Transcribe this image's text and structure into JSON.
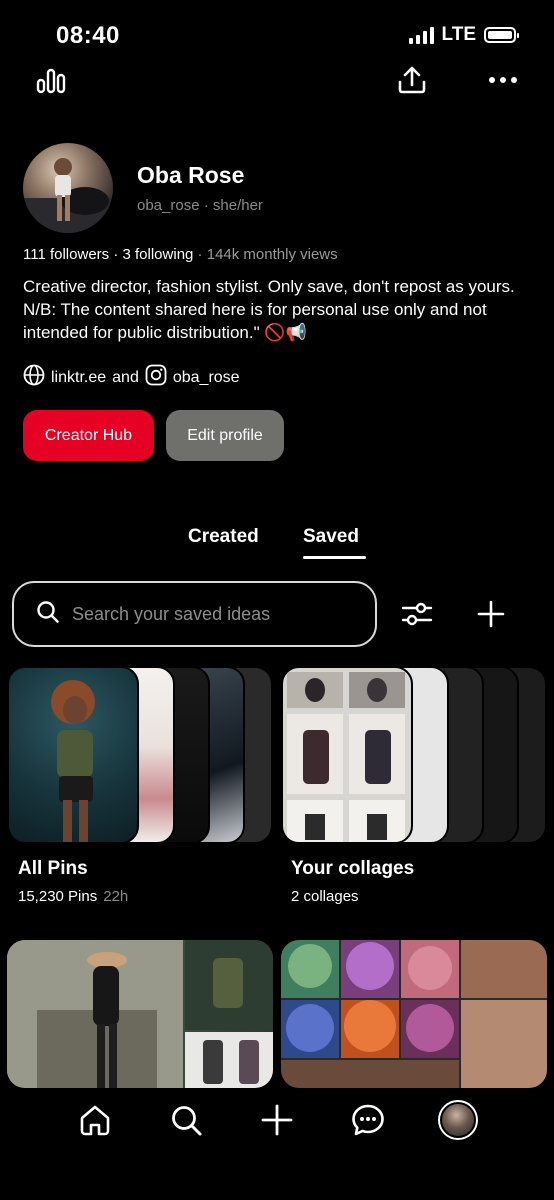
{
  "status_bar": {
    "time": "08:40",
    "network": "LTE"
  },
  "profile": {
    "name": "Oba Rose",
    "handle_line": "oba_rose · she/her",
    "followers": "111 followers",
    "following": "3 following",
    "monthly_views": "144k monthly views",
    "bio": "Creative director, fashion stylist. Only save, don't repost as yours. N/B: The content shared here is for personal use only and not intended for public distribution.\" 🚫📢",
    "link_site": "linktr.ee",
    "link_joiner": "and",
    "link_instagram": "oba_rose"
  },
  "buttons": {
    "creator_hub": "Creator Hub",
    "edit_profile": "Edit profile"
  },
  "tabs": [
    {
      "label": "Created",
      "active": false
    },
    {
      "label": "Saved",
      "active": true
    }
  ],
  "search": {
    "placeholder": "Search your saved ideas"
  },
  "boards": [
    {
      "title": "All Pins",
      "count": "15,230 Pins",
      "updated": "22h"
    },
    {
      "title": "Your collages",
      "count": "2 collages"
    }
  ],
  "icons": {
    "top_left": "stats-icon",
    "top_share": "share-icon",
    "top_more": "more-icon",
    "filter": "filter-icon",
    "add": "plus-icon",
    "nav": [
      "home-icon",
      "search-icon",
      "create-icon",
      "messages-icon",
      "profile-avatar"
    ]
  },
  "colors": {
    "accent": "#e60023",
    "secondary_button": "#6f6f6c",
    "background": "#000000"
  }
}
